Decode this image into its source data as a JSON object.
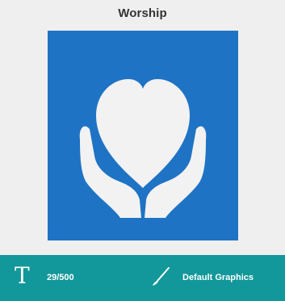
{
  "card": {
    "title": "Worship"
  },
  "image": {
    "icon": "heart-in-hands-icon",
    "background_color": "#1f73c4",
    "icon_color": "#f2f2f2"
  },
  "footer": {
    "background_color": "#12979a",
    "text_icon": "text-T-icon",
    "char_count": "29/500",
    "brush_icon": "brush-icon",
    "graphics_label": "Default Graphics"
  }
}
